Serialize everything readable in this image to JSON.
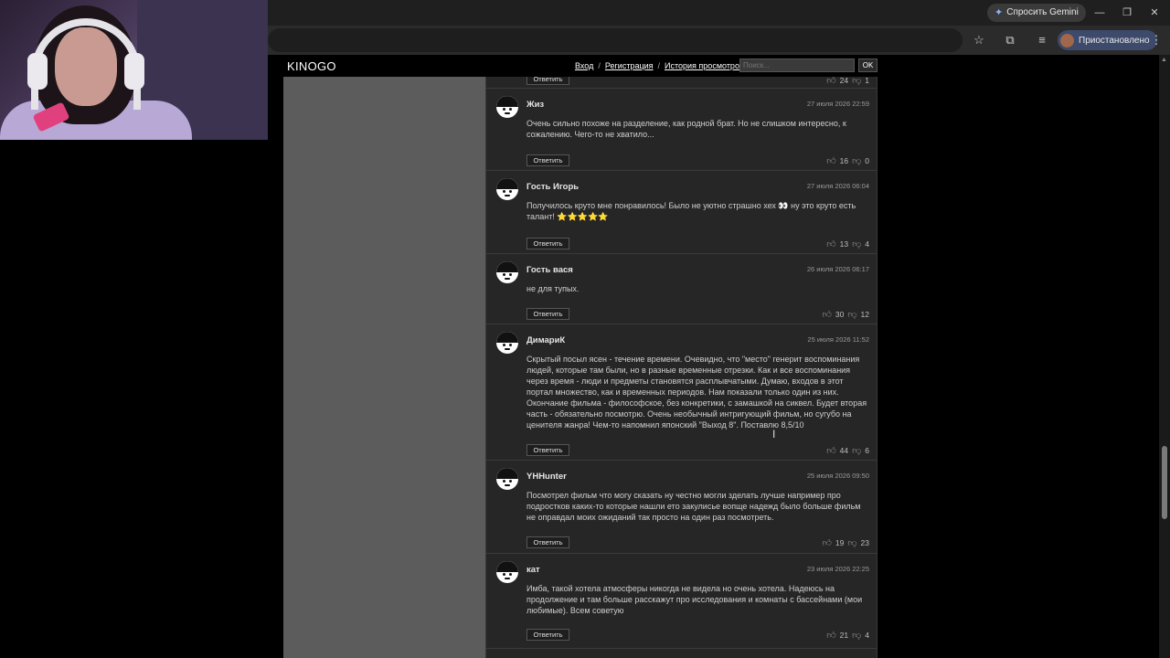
{
  "browser": {
    "gemini_label": "Спросить Gemini",
    "profile_label": "Приостановлено"
  },
  "site": {
    "logo": "KINOGO",
    "nav": [
      "Вход",
      "Регистрация",
      "История просмотров"
    ],
    "search_placeholder": "Поиск...",
    "search_button": "OK"
  },
  "comments": [
    {
      "author": "",
      "date": "",
      "text": "",
      "reply": "Ответить",
      "likes": "24",
      "dislikes": "1"
    },
    {
      "author": "Жиз",
      "date": "27 июля 2026 22:59",
      "text": "Очень сильно похоже на разделение, как родной брат. Но не слишком интересно, к сожалению. Чего-то не хватило...",
      "reply": "Ответить",
      "likes": "16",
      "dislikes": "0"
    },
    {
      "author": "Гость Игорь",
      "date": "27 июля 2026 06:04",
      "text": "Получилось круто мне понравилось! Было не уютно страшно хех 👀 ну это круто есть талант! ⭐⭐⭐⭐⭐",
      "reply": "Ответить",
      "likes": "13",
      "dislikes": "4"
    },
    {
      "author": "Гость вася",
      "date": "26 июля 2026 06:17",
      "text": "не для тупых.",
      "reply": "Ответить",
      "likes": "30",
      "dislikes": "12"
    },
    {
      "author": "ДимариК",
      "date": "25 июля 2026 11:52",
      "text": "Скрытый посыл ясен - течение времени. Очевидно, что \"место\" генерит воспоминания людей, которые там были, но в разные временные отрезки. Как и все воспоминания через время - люди и предметы становятся расплывчатыми. Думаю, входов в этот портал множество, как и временных периодов. Нам показали только один из них. Окончание фильма - философское, без конкретики, с замашкой на сиквел. Будет вторая часть - обязательно посмотрю. Очень необычный интригующий фильм, но сугубо на ценителя жанра! Чем-то напомнил японский \"Выход 8\". Поставлю 8,5/10",
      "reply": "Ответить",
      "likes": "44",
      "dislikes": "6"
    },
    {
      "author": "YHHunter",
      "date": "25 июля 2026 09:50",
      "text": "Посмотрел фильм что могу сказать ну честно могли зделать лучше например про подростков каких-то которые нашли ето закулисье вопще надежд было больше фильм не оправдал моих ожиданий так просто на один раз посмотреть.",
      "reply": "Ответить",
      "likes": "19",
      "dislikes": "23"
    },
    {
      "author": "кат",
      "date": "23 июля 2026 22:25",
      "text": "Имба, такой хотела атмосферы никогда не видела но очень хотела. Надеюсь на продолжение и там больше расскажут про исследования и комнаты с бассейнами (мои любимые). Всем советую",
      "reply": "Ответить",
      "likes": "21",
      "dislikes": "4"
    }
  ]
}
